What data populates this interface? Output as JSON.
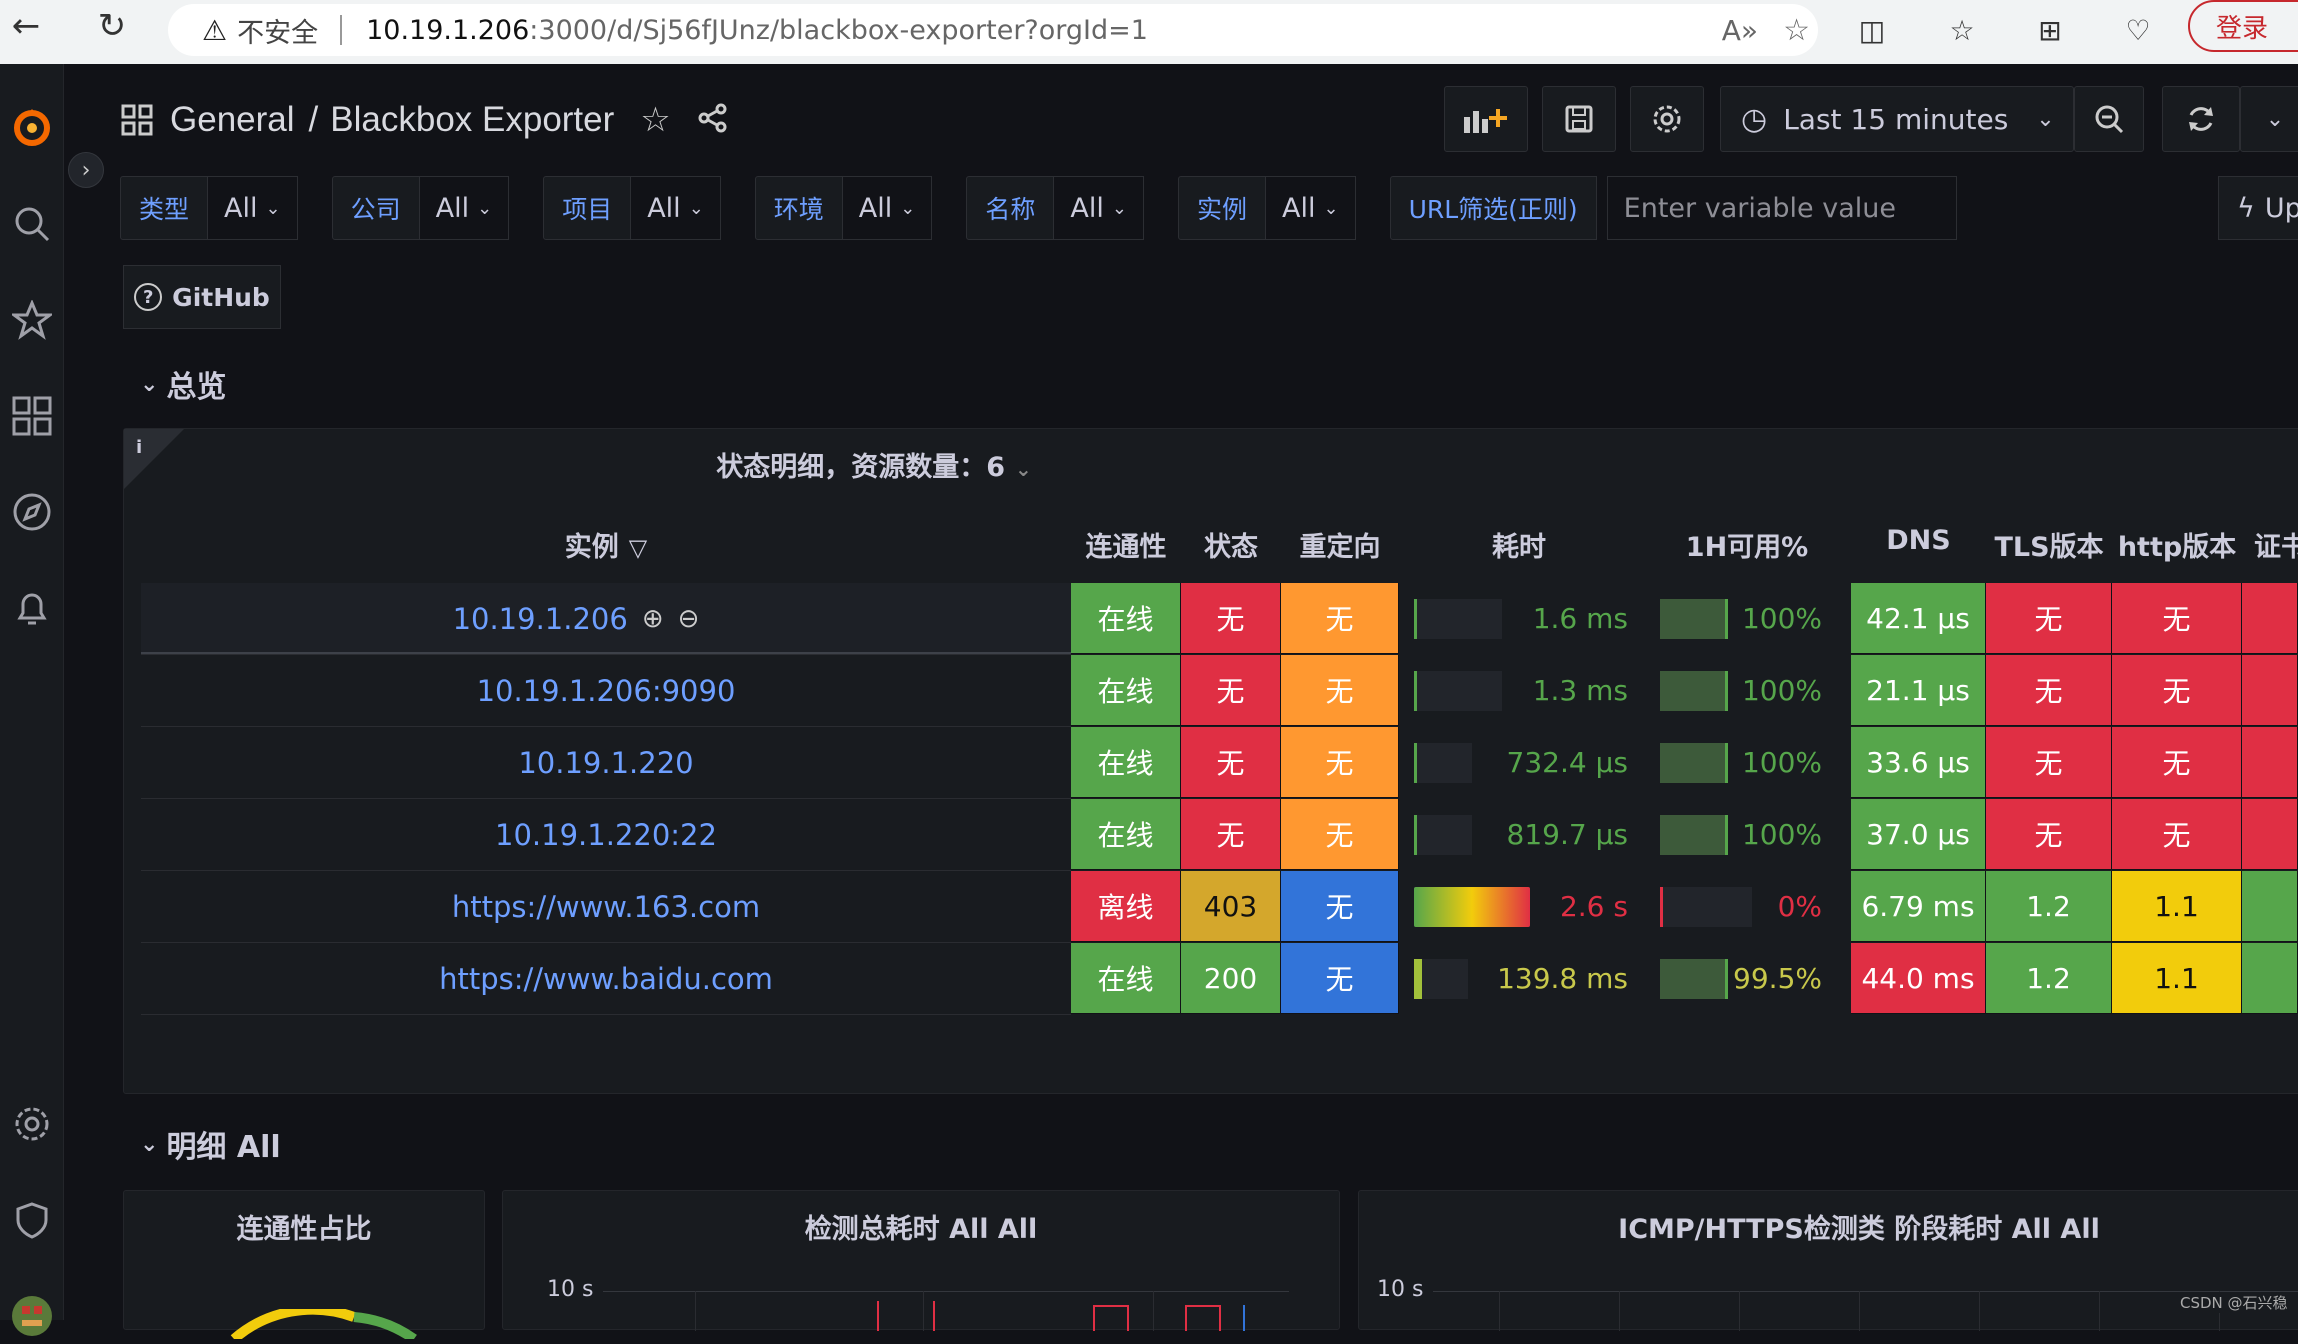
{
  "browser": {
    "insecure_label": "不安全",
    "url_host": "10.19.1.206",
    "url_path": ":3000/d/Sj56fJUnz/blackbox-exporter?orgId=1",
    "login_label": "登录"
  },
  "header": {
    "folder": "General",
    "separator": "/",
    "dashboard": "Blackbox Exporter",
    "time_range": "Last 15 minutes"
  },
  "variables": [
    {
      "label": "类型",
      "value": "All"
    },
    {
      "label": "公司",
      "value": "All"
    },
    {
      "label": "项目",
      "value": "All"
    },
    {
      "label": "环境",
      "value": "All"
    },
    {
      "label": "名称",
      "value": "All"
    },
    {
      "label": "实例",
      "value": "All"
    }
  ],
  "url_filter": {
    "label": "URL筛选(正则)",
    "placeholder": "Enter variable value"
  },
  "update_label": "Up",
  "github_label": "GitHub",
  "rows": {
    "overview": "总览",
    "detail": "明细 All"
  },
  "table_panel": {
    "info": "i",
    "title": "状态明细，资源数量：6",
    "headers": {
      "instance": "实例",
      "conn": "连通性",
      "status": "状态",
      "redirect": "重定向",
      "duration": "耗时",
      "avail": "1H可用%",
      "dns": "DNS",
      "tls": "TLS版本",
      "http": "http版本",
      "cert": "证书"
    },
    "rows": [
      {
        "instance": "10.19.1.206",
        "conn": "在线",
        "status": "无",
        "redirect": "无",
        "duration": "1.6 ms",
        "duration_frac": 0.02,
        "avail": "100%",
        "avail_frac": 1.0,
        "dns": "42.1 μs",
        "tls": "无",
        "http": "无"
      },
      {
        "instance": "10.19.1.206:9090",
        "conn": "在线",
        "status": "无",
        "redirect": "无",
        "duration": "1.3 ms",
        "duration_frac": 0.02,
        "avail": "100%",
        "avail_frac": 1.0,
        "dns": "21.1 μs",
        "tls": "无",
        "http": "无"
      },
      {
        "instance": "10.19.1.220",
        "conn": "在线",
        "status": "无",
        "redirect": "无",
        "duration": "732.4 μs",
        "duration_frac": 0.02,
        "avail": "100%",
        "avail_frac": 1.0,
        "dns": "33.6 μs",
        "tls": "无",
        "http": "无"
      },
      {
        "instance": "10.19.1.220:22",
        "conn": "在线",
        "status": "无",
        "redirect": "无",
        "duration": "819.7 μs",
        "duration_frac": 0.02,
        "avail": "100%",
        "avail_frac": 1.0,
        "dns": "37.0 μs",
        "tls": "无",
        "http": "无"
      },
      {
        "instance": "https://www.163.com",
        "conn": "离线",
        "status": "403",
        "redirect": "无",
        "duration": "2.6 s",
        "duration_frac": 1.0,
        "avail": "0%",
        "avail_frac": 0.0,
        "dns": "6.79 ms",
        "tls": "1.2",
        "http": "1.1"
      },
      {
        "instance": "https://www.baidu.com",
        "conn": "在线",
        "status": "200",
        "redirect": "无",
        "duration": "139.8 ms",
        "duration_frac": 0.15,
        "avail": "99.5%",
        "avail_frac": 0.995,
        "dns": "44.0 ms",
        "tls": "1.2",
        "http": "1.1"
      }
    ]
  },
  "bottom_panels": [
    {
      "title": "连通性占比"
    },
    {
      "title": "检测总耗时 All All",
      "ytick": "10 s"
    },
    {
      "title": "ICMP/HTTPS检测类 阶段耗时 All All",
      "ytick": "10 s"
    }
  ],
  "watermark": "CSDN @石兴稳",
  "colors": {
    "green": "#56a64b",
    "red": "#e02f44",
    "orange": "#ff9830",
    "blue": "#3274d9",
    "yellow": "#f2cc0c",
    "link": "#6e9fff"
  }
}
